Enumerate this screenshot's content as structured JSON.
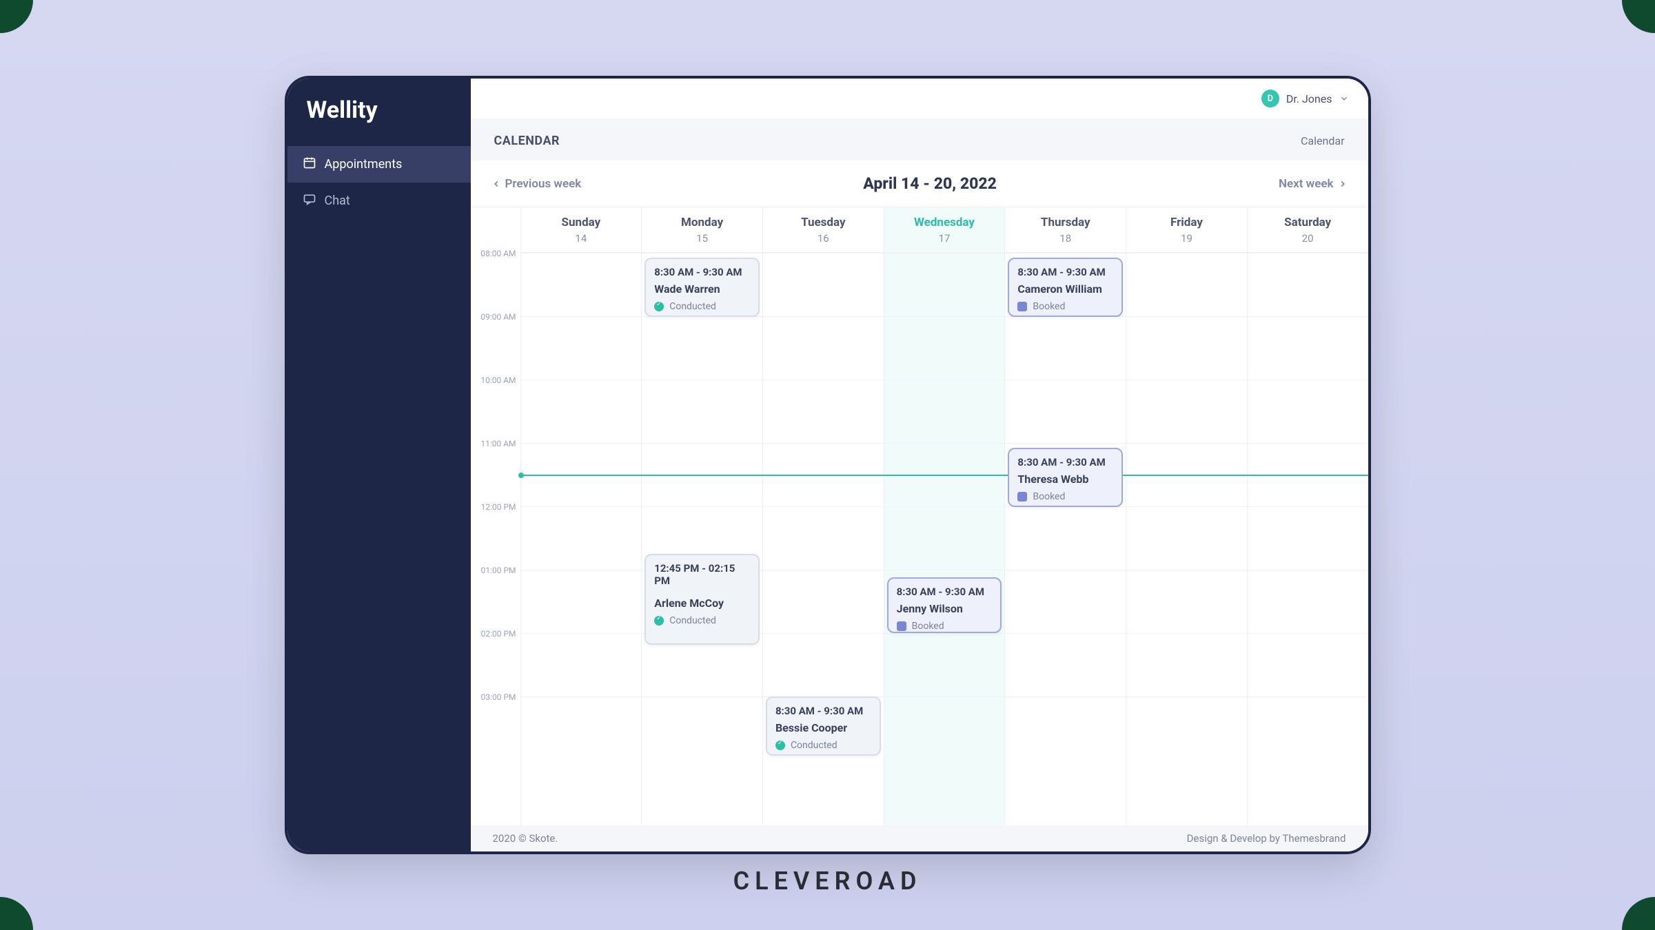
{
  "brand": "Wellity",
  "sidebar": {
    "items": [
      {
        "label": "Appointments",
        "active": true,
        "icon": "calendar"
      },
      {
        "label": "Chat",
        "active": false,
        "icon": "chat"
      }
    ]
  },
  "topbar": {
    "user": {
      "initial": "D",
      "name": "Dr. Jones"
    }
  },
  "page": {
    "title": "CALENDAR",
    "breadcrumb": "Calendar"
  },
  "weeknav": {
    "prev": "Previous week",
    "next": "Next week",
    "range": "April 14 - 20, 2022"
  },
  "days": [
    {
      "name": "Sunday",
      "num": "14",
      "today": false
    },
    {
      "name": "Monday",
      "num": "15",
      "today": false
    },
    {
      "name": "Tuesday",
      "num": "16",
      "today": false
    },
    {
      "name": "Wednesday",
      "num": "17",
      "today": true
    },
    {
      "name": "Thursday",
      "num": "18",
      "today": false
    },
    {
      "name": "Friday",
      "num": "19",
      "today": false
    },
    {
      "name": "Saturday",
      "num": "20",
      "today": false
    }
  ],
  "hours": [
    "08:00 AM",
    "09:00 AM",
    "10:00 AM",
    "11:00 AM",
    "12:00 PM",
    "01:00 PM",
    "02:00 PM",
    "03:00 PM"
  ],
  "nowRow": 3.5,
  "events": [
    {
      "day": 1,
      "startRow": 0.08,
      "span": 1,
      "time": "8:30 AM - 9:30 AM",
      "name": "Wade Warren",
      "status": "Conducted",
      "kind": "conducted",
      "short": true
    },
    {
      "day": 4,
      "startRow": 0.08,
      "span": 1,
      "time": "8:30 AM - 9:30 AM",
      "name": "Cameron William",
      "status": "Booked",
      "kind": "booked",
      "short": true
    },
    {
      "day": 4,
      "startRow": 3.08,
      "span": 1,
      "time": "8:30 AM - 9:30 AM",
      "name": "Theresa Webb",
      "status": "Booked",
      "kind": "booked",
      "short": true
    },
    {
      "day": 1,
      "startRow": 4.75,
      "span": 1.5,
      "time": "12:45 PM - 02:15 PM",
      "name": "Arlene McCoy",
      "status": "Conducted",
      "kind": "conducted",
      "short": false
    },
    {
      "day": 3,
      "startRow": 5.12,
      "span": 0.95,
      "time": "8:30 AM - 9:30 AM",
      "name": "Jenny Wilson",
      "status": "Booked",
      "kind": "booked",
      "short": true
    },
    {
      "day": 2,
      "startRow": 7.0,
      "span": 1,
      "time": "8:30 AM - 9:30 AM",
      "name": "Bessie Cooper",
      "status": "Conducted",
      "kind": "conducted",
      "short": true
    }
  ],
  "footer": {
    "left": "2020 © Skote.",
    "right": "Design & Develop by Themesbrand"
  },
  "watermark": "CLEVEROAD"
}
